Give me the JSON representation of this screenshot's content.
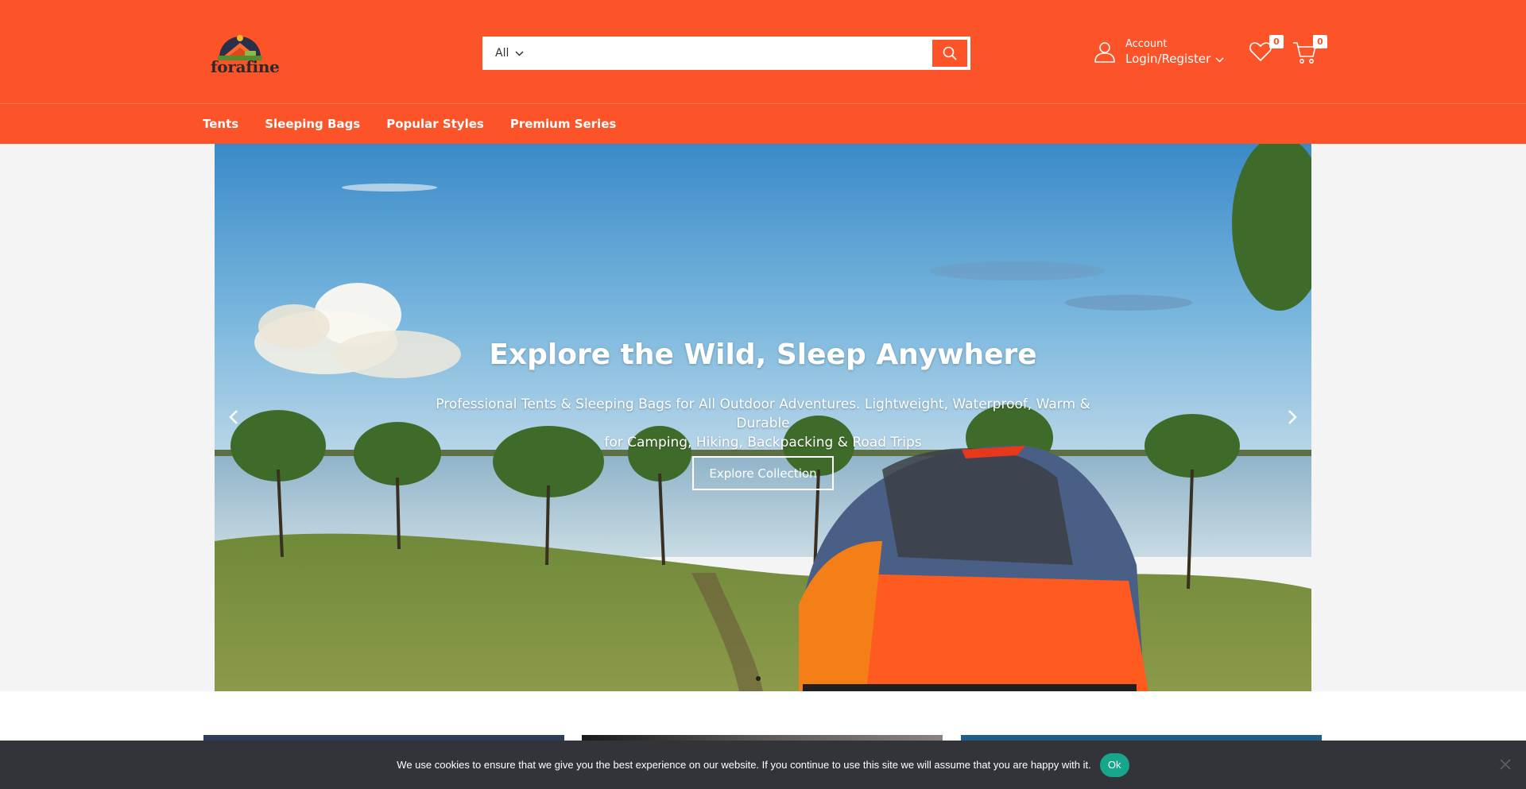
{
  "brand": {
    "name": "forafine"
  },
  "search": {
    "category": "All",
    "placeholder": ""
  },
  "account": {
    "label": "Account",
    "link": "Login/Register"
  },
  "wishlist": {
    "count": "0"
  },
  "cart": {
    "count": "0"
  },
  "nav": {
    "items": [
      "Tents",
      "Sleeping Bags",
      "Popular Styles",
      "Premium Series"
    ]
  },
  "hero": {
    "title": "Explore the Wild, Sleep Anywhere",
    "subtitle_line1": "Professional Tents & Sleeping Bags for All Outdoor Adventures. Lightweight, Waterproof, Warm & Durable",
    "subtitle_line2": "for Camping, Hiking, Backpacking & Road Trips",
    "button": "Explore Collection"
  },
  "cookie": {
    "text": "We use cookies to ensure that we give you the best experience on our website. If you continue to use this site we will assume that you are happy with it.",
    "ok": "Ok"
  },
  "colors": {
    "brand": "#fd5329",
    "cookie_bg": "#32343a",
    "cookie_ok": "#17a58b"
  },
  "icons": [
    "search-icon",
    "user-icon",
    "heart-icon",
    "cart-icon",
    "chevron-left-icon",
    "chevron-right-icon",
    "close-icon",
    "chevron-down-icon"
  ]
}
